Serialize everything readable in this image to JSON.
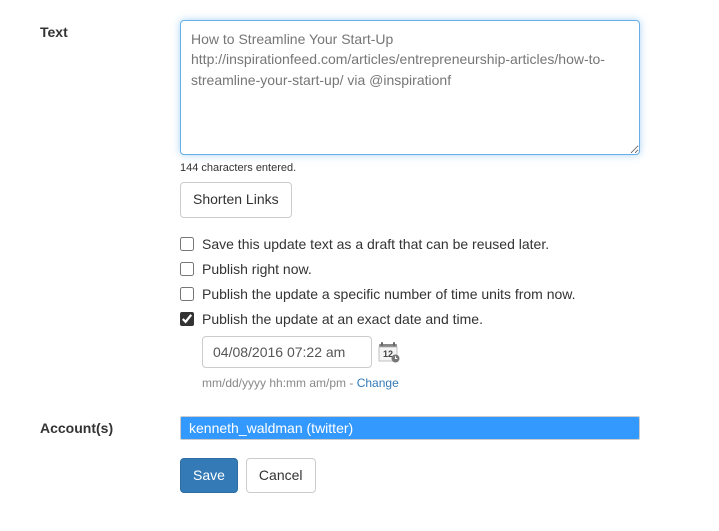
{
  "labels": {
    "text": "Text",
    "accounts": "Account(s)"
  },
  "textarea": {
    "value": "How to Streamline Your Start-Up http://inspirationfeed.com/articles/entrepreneurship-articles/how-to-streamline-your-start-up/ via @inspirationf"
  },
  "char_count": "144 characters entered.",
  "buttons": {
    "shorten": "Shorten Links",
    "save": "Save",
    "cancel": "Cancel"
  },
  "options": {
    "save_draft": "Save this update text as a draft that can be reused later.",
    "publish_now": "Publish right now.",
    "publish_relative": "Publish the update a specific number of time units from now.",
    "publish_exact": "Publish the update at an exact date and time."
  },
  "datetime": {
    "value": "04/08/2016 07:22 am",
    "format_hint": "mm/dd/yyyy hh:mm am/pm",
    "change": "Change"
  },
  "accounts": {
    "selected": "kenneth_waldman (twitter)"
  }
}
